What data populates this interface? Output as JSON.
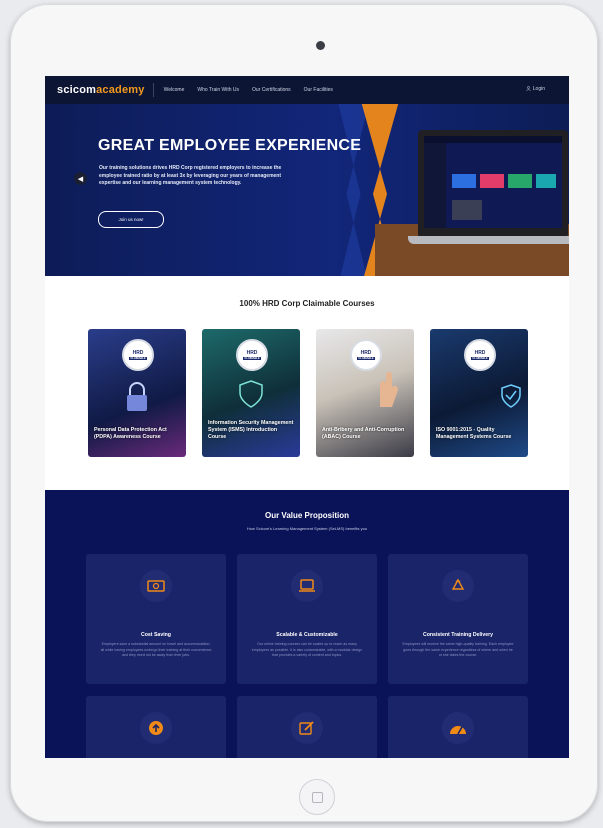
{
  "nav": {
    "logo_main": "scicom",
    "logo_accent": "academy",
    "links": [
      "Welcome",
      "Who Train With Us",
      "Our Certifications",
      "Our Facilities"
    ],
    "login": "Login"
  },
  "hero": {
    "title": "GREAT EMPLOYEE EXPERIENCE",
    "text": "Our training solutions drives HRD Corp registered employers to increase the employee trained ratio by at least 3x by leveraging our years of management expertise and our learning management system technology.",
    "button": "Join us now!"
  },
  "courses": {
    "title": "100% HRD Corp Claimable Courses",
    "badge_top": "HRD",
    "badge_bottom": "CLAIMABLE",
    "items": [
      {
        "label": "Personal Data Protection Act (PDPA) Awareness Course"
      },
      {
        "label": "Information Security Management System (ISMS) Introduction Course"
      },
      {
        "label": "Anti-Bribery and Anti-Corruption (ABAC) Course"
      },
      {
        "label": "ISO 9001:2015 - Quality Management Systems Course"
      }
    ]
  },
  "value": {
    "title": "Our Value Proposition",
    "subtitle": "How Scicom's Learning Management System (SeLMS) benefits you",
    "cards": [
      {
        "icon": "money-icon",
        "title": "Cost Saving",
        "text": "Employers save a substantial amount on travel and accommodation; all while having employees undergo their training at their convenience and they need not be away from their jobs."
      },
      {
        "icon": "laptop-icon",
        "title": "Scalable & Customizable",
        "text": "Our online training courses can be scaled up to reach as many employees as possible. It is also customizable, with a modular design that provides a variety of content and topics."
      },
      {
        "icon": "recycle-icon",
        "title": "Consistent Training Delivery",
        "text": "Employees will receive the same high-quality training. Each employee goes through the same experience regardless of where and when he or she takes the course."
      },
      {
        "icon": "upload-icon",
        "title": "",
        "text": ""
      },
      {
        "icon": "edit-icon",
        "title": "",
        "text": ""
      },
      {
        "icon": "gauge-icon",
        "title": "",
        "text": ""
      }
    ]
  },
  "colors": {
    "accent": "#f08a17",
    "nav_bg": "#0c1534",
    "hero_bg": "#12267a",
    "value_bg": "#0b1358",
    "card_bg": "#1a2468"
  }
}
